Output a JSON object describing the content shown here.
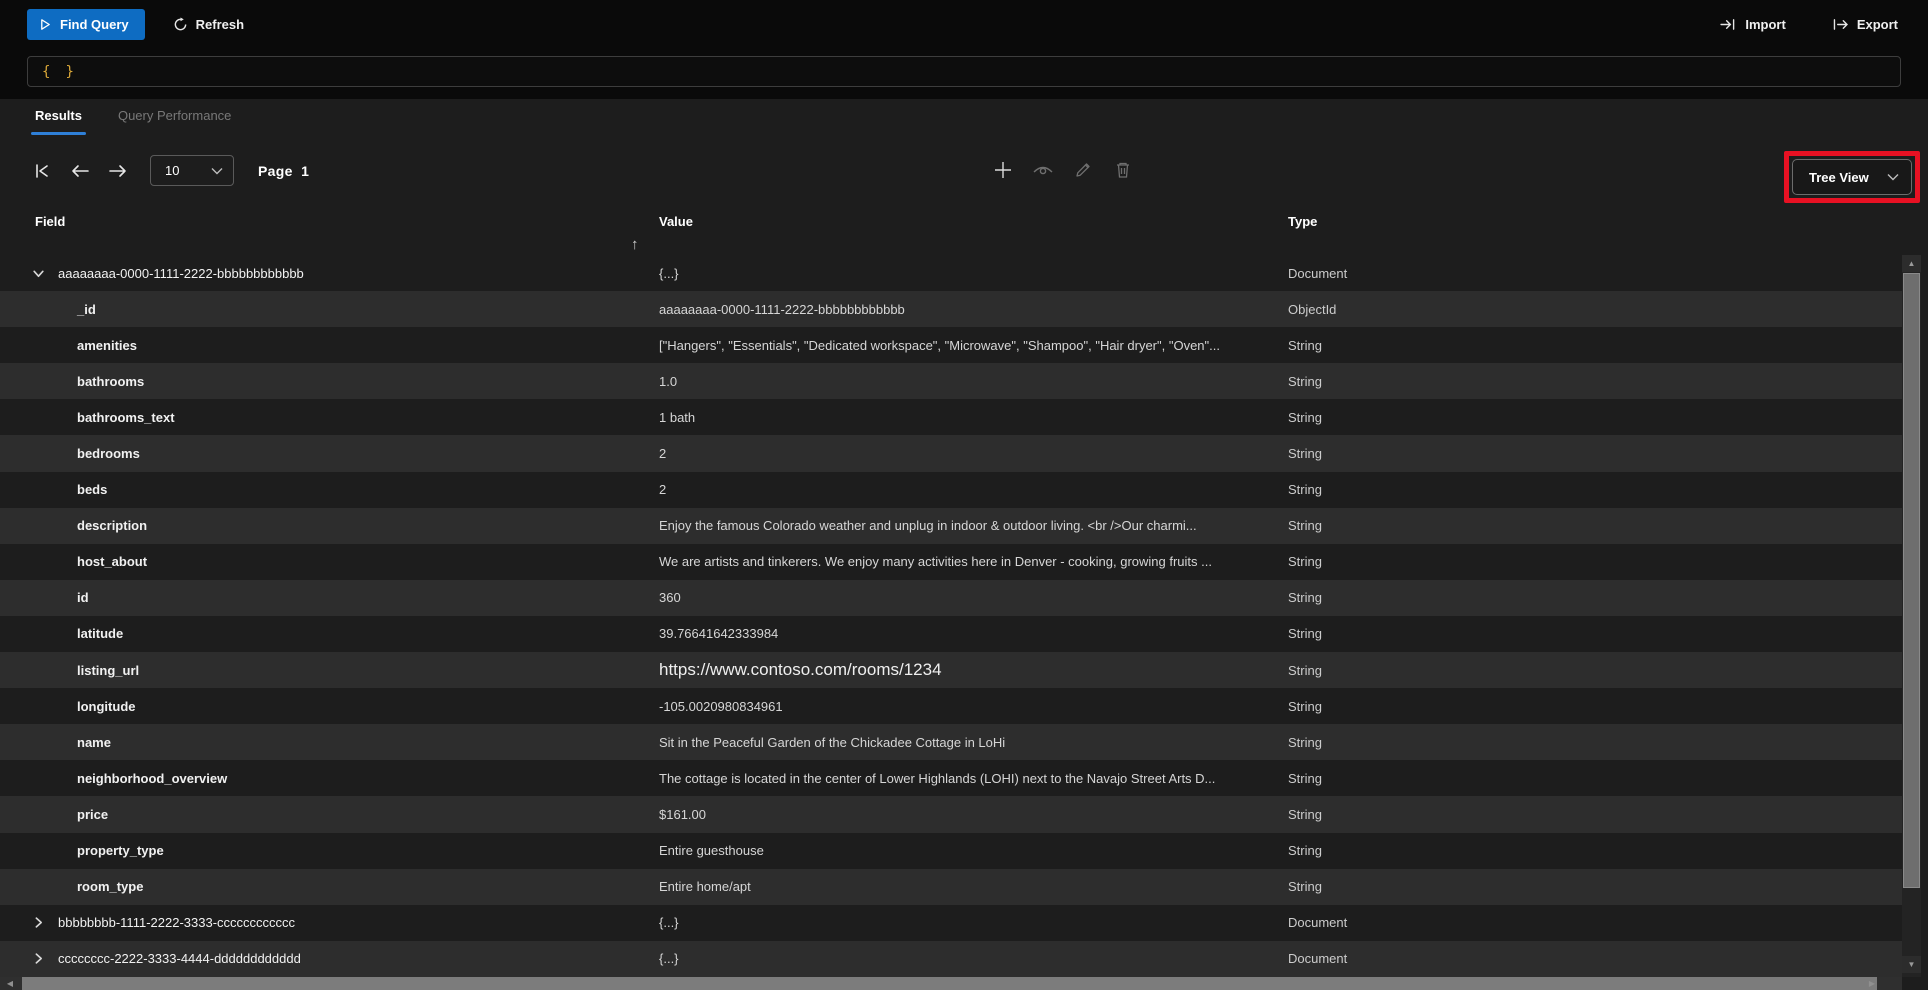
{
  "toolbar": {
    "find_query_label": "Find Query",
    "refresh_label": "Refresh",
    "import_label": "Import",
    "export_label": "Export"
  },
  "query_editor": {
    "open_brace": "{",
    "close_brace": "}"
  },
  "tabs": {
    "results": "Results",
    "query_performance": "Query Performance"
  },
  "pagination": {
    "page_size": "10",
    "page_word": "Page",
    "page_number": "1"
  },
  "view_dropdown": {
    "selected": "Tree View"
  },
  "table": {
    "headers": {
      "field": "Field",
      "value": "Value",
      "type": "Type"
    },
    "sort_icon": "↑",
    "rows": [
      {
        "field": "aaaaaaaa-0000-1111-2222-bbbbbbbbbbbb",
        "value": "{...}",
        "type": "Document",
        "level": 0,
        "expander": "expanded"
      },
      {
        "field": "_id",
        "value": "aaaaaaaa-0000-1111-2222-bbbbbbbbbbbb",
        "type": "ObjectId",
        "level": 1
      },
      {
        "field": "amenities",
        "value": "[\"Hangers\", \"Essentials\", \"Dedicated workspace\", \"Microwave\", \"Shampoo\", \"Hair dryer\", \"Oven\"...",
        "type": "String",
        "level": 1
      },
      {
        "field": "bathrooms",
        "value": "1.0",
        "type": "String",
        "level": 1
      },
      {
        "field": "bathrooms_text",
        "value": "1 bath",
        "type": "String",
        "level": 1
      },
      {
        "field": "bedrooms",
        "value": "2",
        "type": "String",
        "level": 1
      },
      {
        "field": "beds",
        "value": "2",
        "type": "String",
        "level": 1
      },
      {
        "field": "description",
        "value": "Enjoy the famous Colorado weather and unplug in indoor & outdoor living. <br />Our charmi...",
        "type": "String",
        "level": 1
      },
      {
        "field": "host_about",
        "value": "We are artists and tinkerers. We enjoy many activities here in Denver - cooking, growing fruits ...",
        "type": "String",
        "level": 1
      },
      {
        "field": "id",
        "value": "360",
        "type": "String",
        "level": 1
      },
      {
        "field": "latitude",
        "value": "39.76641642333984",
        "type": "String",
        "level": 1
      },
      {
        "field": "listing_url",
        "value": "https://www.contoso.com/rooms/1234",
        "type": "String",
        "level": 1,
        "large": true
      },
      {
        "field": "longitude",
        "value": "-105.0020980834961",
        "type": "String",
        "level": 1
      },
      {
        "field": "name",
        "value": "Sit in the Peaceful Garden of the Chickadee Cottage in LoHi",
        "type": "String",
        "level": 1
      },
      {
        "field": "neighborhood_overview",
        "value": "The cottage is located in the center of Lower Highlands (LOHI) next to the Navajo Street Arts D...",
        "type": "String",
        "level": 1
      },
      {
        "field": "price",
        "value": "$161.00",
        "type": "String",
        "level": 1
      },
      {
        "field": "property_type",
        "value": "Entire guesthouse",
        "type": "String",
        "level": 1
      },
      {
        "field": "room_type",
        "value": "Entire home/apt",
        "type": "String",
        "level": 1
      },
      {
        "field": "bbbbbbbb-1111-2222-3333-cccccccccccc",
        "value": "{...}",
        "type": "Document",
        "level": 0,
        "expander": "collapsed"
      },
      {
        "field": "cccccccc-2222-3333-4444-dddddddddddd",
        "value": "{...}",
        "type": "Document",
        "level": 0,
        "expander": "collapsed"
      }
    ]
  },
  "colors": {
    "accent_blue": "#0e6cc2",
    "tab_underline": "#2f80d8",
    "brace_gold": "#d9a738",
    "highlight_red": "#e81123",
    "row_stripe": "#2d2d2d"
  }
}
